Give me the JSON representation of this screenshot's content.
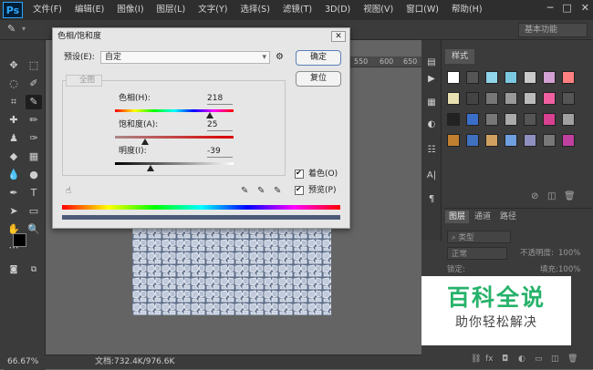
{
  "app": {
    "logo": "Ps"
  },
  "menus": [
    "文件(F)",
    "编辑(E)",
    "图像(I)",
    "图层(L)",
    "文字(Y)",
    "选择(S)",
    "滤镜(T)",
    "3D(D)",
    "视图(V)",
    "窗口(W)",
    "帮助(H)"
  ],
  "window_controls": [
    "─",
    "□",
    "✕"
  ],
  "options": {
    "workspace": "基本功能"
  },
  "ruler": {
    "marks": [
      "550",
      "600",
      "650"
    ]
  },
  "status": {
    "zoom": "66.67%",
    "doc": "文档:732.4K/976.6K"
  },
  "dialog": {
    "title": "色相/饱和度",
    "close": "✕",
    "preset_label": "预设(E):",
    "preset_value": "自定",
    "ok": "确定",
    "reset": "复位",
    "master": "全图",
    "hue_label": "色相(H):",
    "hue_value": "218",
    "hue_level": 0.8,
    "sat_label": "饱和度(A):",
    "sat_value": "25",
    "sat_level": 0.25,
    "light_label": "明度(I):",
    "light_value": "-39",
    "light_level": 0.3,
    "colorize_label": "着色(O)",
    "colorize_checked": true,
    "preview_label": "预览(P)",
    "preview_checked": true
  },
  "panels": {
    "styles_tab": "样式",
    "layers_tabs": [
      "图层",
      "通道",
      "路径"
    ],
    "kind_label": "类型",
    "blend_mode": "正常",
    "opacity_label": "不透明度:",
    "opacity_value": "100%",
    "lock_label": "锁定:",
    "fill_label": "填充:",
    "fill_value": "100%"
  },
  "watermark": {
    "title": "百科全说",
    "subtitle": "助你轻松解决"
  },
  "colors": {
    "accent_green": "#26b26a",
    "menubar": "#2e2e2e",
    "panel": "#3b3b3b"
  }
}
